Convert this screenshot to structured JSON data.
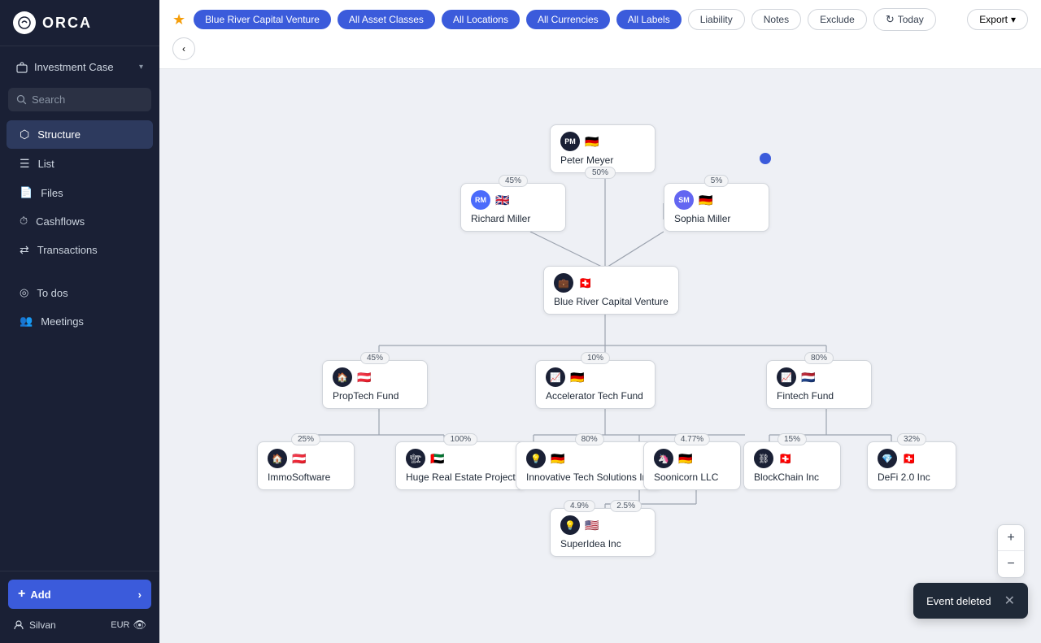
{
  "logo": "ORCA",
  "sidebar": {
    "investment_case": "Investment Case",
    "search_placeholder": "Search",
    "nav_items": [
      {
        "id": "structure",
        "label": "Structure",
        "icon": "⬡",
        "active": true
      },
      {
        "id": "list",
        "label": "List",
        "icon": "☰"
      },
      {
        "id": "files",
        "label": "Files",
        "icon": "📄"
      },
      {
        "id": "cashflows",
        "label": "Cashflows",
        "icon": "⏱"
      },
      {
        "id": "transactions",
        "label": "Transactions",
        "icon": "⇄"
      },
      {
        "id": "todos",
        "label": "To dos",
        "icon": "◎"
      },
      {
        "id": "meetings",
        "label": "Meetings",
        "icon": "👥"
      }
    ],
    "add_button": "Add",
    "user": "Silvan",
    "currency": "EUR"
  },
  "topbar": {
    "filter_main": "Blue River Capital Venture",
    "filter_asset": "All Asset Classes",
    "filter_location": "All Locations",
    "filter_currency": "All Currencies",
    "filter_labels": "All Labels",
    "btn_liability": "Liability",
    "btn_notes": "Notes",
    "btn_exclude": "Exclude",
    "btn_today": "Today",
    "btn_export": "Export"
  },
  "nodes": {
    "peter_meyer": {
      "initials": "PM",
      "name": "Peter Meyer",
      "flag": "🇩🇪"
    },
    "richard_miller": {
      "initials": "RM",
      "name": "Richard Miller",
      "flag": "🇬🇧",
      "pct": "45%"
    },
    "sophia_miller": {
      "initials": "SM",
      "name": "Sophia Miller",
      "flag": "🇩🇪",
      "pct": "5%"
    },
    "blue_river": {
      "name": "Blue River Capital Venture",
      "flag": "🇨🇭",
      "pct": "50%"
    },
    "proptech": {
      "name": "PropTech Fund",
      "flag": "🇦🇹",
      "pct": "45%"
    },
    "accelerator": {
      "name": "Accelerator Tech Fund",
      "flag": "🇩🇪",
      "pct": "10%"
    },
    "fintech": {
      "name": "Fintech Fund",
      "flag": "🇳🇱",
      "pct": "80%"
    },
    "immo": {
      "name": "ImmoSoftware",
      "flag": "🇦🇹",
      "pct": "25%"
    },
    "huge_real": {
      "name": "Huge Real Estate Project",
      "flag": "🇦🇪",
      "pct": "100%"
    },
    "innovative": {
      "name": "Innovative Tech Solutions Inc",
      "flag": "🇩🇪",
      "pct": "80%"
    },
    "soonicorn": {
      "name": "Soonicorn LLC",
      "flag": "🇩🇪",
      "pct": "4.77%"
    },
    "blockchain": {
      "name": "BlockChain Inc",
      "flag": "🇨🇭",
      "pct": "15%"
    },
    "defi": {
      "name": "DeFi 2.0 Inc",
      "flag": "🇨🇭",
      "pct": "32%"
    },
    "superidea": {
      "name": "SuperIdea Inc",
      "flag": "🇺🇸",
      "pct1": "4.9%",
      "pct2": "2.5%"
    }
  },
  "toast": {
    "message": "Event deleted"
  },
  "zoom": {
    "plus": "+",
    "minus": "−"
  }
}
